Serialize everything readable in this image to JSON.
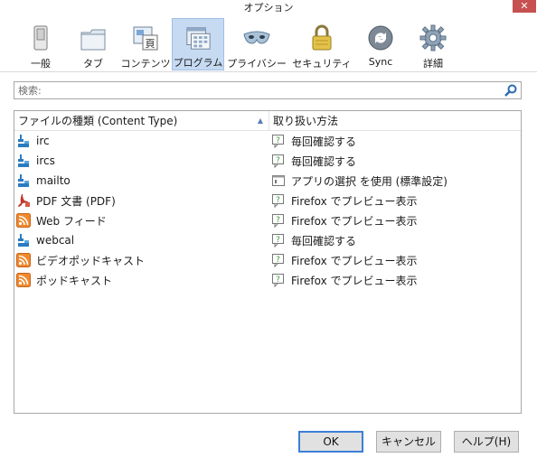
{
  "window": {
    "title": "オプション",
    "close_glyph": "✕"
  },
  "toolbar": {
    "items": [
      {
        "label": "一般",
        "icon": "general-icon"
      },
      {
        "label": "タブ",
        "icon": "tabs-icon"
      },
      {
        "label": "コンテンツ",
        "icon": "content-icon"
      },
      {
        "label": "プログラム",
        "icon": "applications-icon",
        "active": true
      },
      {
        "label": "プライバシー",
        "icon": "privacy-mask-icon"
      },
      {
        "label": "セキュリティ",
        "icon": "lock-icon"
      },
      {
        "label": "Sync",
        "icon": "sync-icon"
      },
      {
        "label": "詳細",
        "icon": "gear-icon"
      }
    ]
  },
  "search": {
    "placeholder": "検索:"
  },
  "table": {
    "headers": {
      "content_type": "ファイルの種類 (Content Type)",
      "action": "取り扱い方法"
    },
    "rows": [
      {
        "type": "irc",
        "action": "毎回確認する",
        "type_icon": "plugin-icon",
        "action_icon": "ask-icon"
      },
      {
        "type": "ircs",
        "action": "毎回確認する",
        "type_icon": "plugin-icon",
        "action_icon": "ask-icon"
      },
      {
        "type": "mailto",
        "action": "アプリの選択 を使用 (標準設定)",
        "type_icon": "plugin-icon",
        "action_icon": "app-window-icon"
      },
      {
        "type": "PDF 文書 (PDF)",
        "action": "Firefox でプレビュー表示",
        "type_icon": "pdf-icon",
        "action_icon": "ask-icon"
      },
      {
        "type": "Web フィード",
        "action": "Firefox でプレビュー表示",
        "type_icon": "feed-icon",
        "action_icon": "ask-icon"
      },
      {
        "type": "webcal",
        "action": "毎回確認する",
        "type_icon": "plugin-icon",
        "action_icon": "ask-icon"
      },
      {
        "type": "ビデオポッドキャスト",
        "action": "Firefox でプレビュー表示",
        "type_icon": "feed-icon",
        "action_icon": "ask-icon"
      },
      {
        "type": "ポッドキャスト",
        "action": "Firefox でプレビュー表示",
        "type_icon": "feed-icon",
        "action_icon": "ask-icon"
      }
    ]
  },
  "buttons": {
    "ok": "OK",
    "cancel": "キャンセル",
    "help": "ヘルプ(H)"
  },
  "colors": {
    "active_tab": "#c6daf2",
    "close": "#c75050",
    "feed": "#f0892e",
    "pdf": "#c0392b",
    "plugin": "#2a7bc0"
  }
}
